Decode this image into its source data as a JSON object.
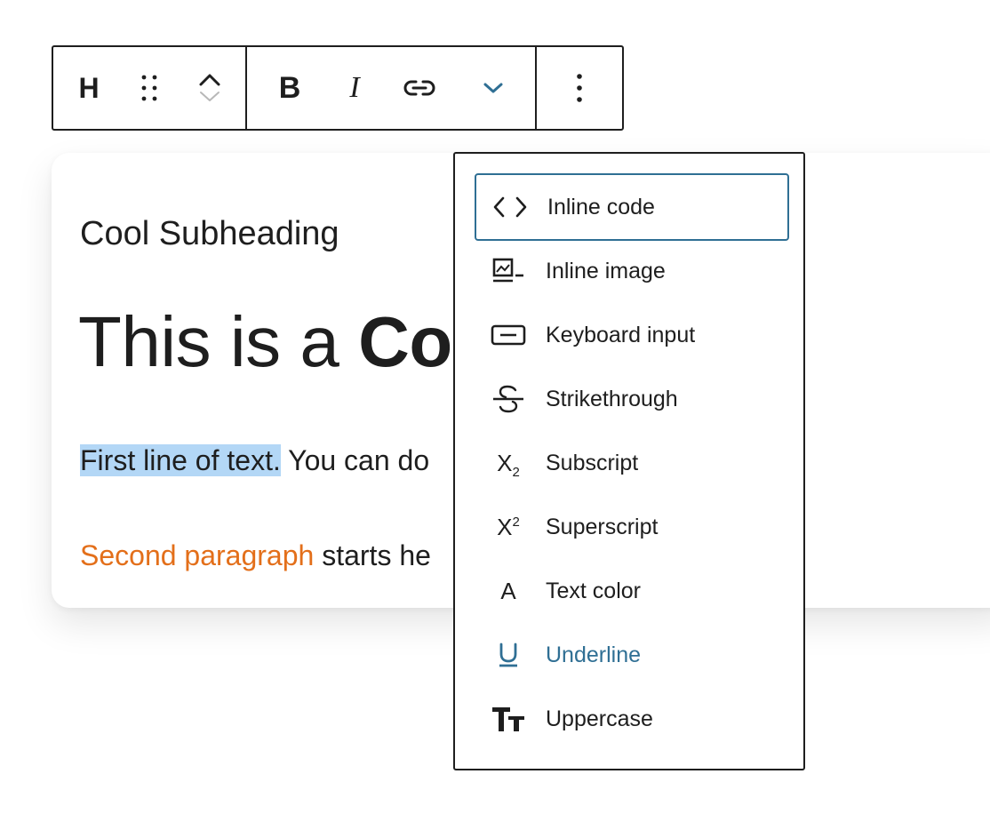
{
  "toolbar": {
    "block_type_label": "H",
    "bold_label": "B",
    "italic_label": "I",
    "icons": [
      "heading-icon",
      "drag-handle-icon",
      "move-up-icon",
      "move-down-icon",
      "bold-icon",
      "italic-icon",
      "link-icon",
      "chevron-down-icon",
      "more-vertical-icon"
    ]
  },
  "content": {
    "subheading": "Cool Subheading",
    "heading_plain": "This is a ",
    "heading_bold": "Co",
    "para1_highlighted": "First line of text.",
    "para1_rest": " You can do",
    "para2_accent": "Second paragraph",
    "para2_rest": " starts he"
  },
  "format_menu": {
    "items": [
      {
        "label": "Inline code",
        "icon": "code-icon"
      },
      {
        "label": "Inline image",
        "icon": "image-icon"
      },
      {
        "label": "Keyboard input",
        "icon": "keyboard-icon"
      },
      {
        "label": "Strikethrough",
        "icon": "strikethrough-icon"
      },
      {
        "label": "Subscript",
        "icon": "subscript-icon"
      },
      {
        "label": "Superscript",
        "icon": "superscript-icon"
      },
      {
        "label": "Text color",
        "icon": "text-color-icon"
      },
      {
        "label": "Underline",
        "icon": "underline-icon"
      },
      {
        "label": "Uppercase",
        "icon": "uppercase-icon"
      }
    ],
    "focused_item": "Inline code",
    "active_item": "Underline",
    "subscript_glyph": "X",
    "subscript_digit": "2",
    "superscript_glyph": "X",
    "superscript_digit": "2",
    "text_color_glyph": "A"
  },
  "colors": {
    "accent": "#2f6f94",
    "highlight": "#b3d7f6",
    "orange": "#e36f1a",
    "text": "#1e1e1e"
  }
}
